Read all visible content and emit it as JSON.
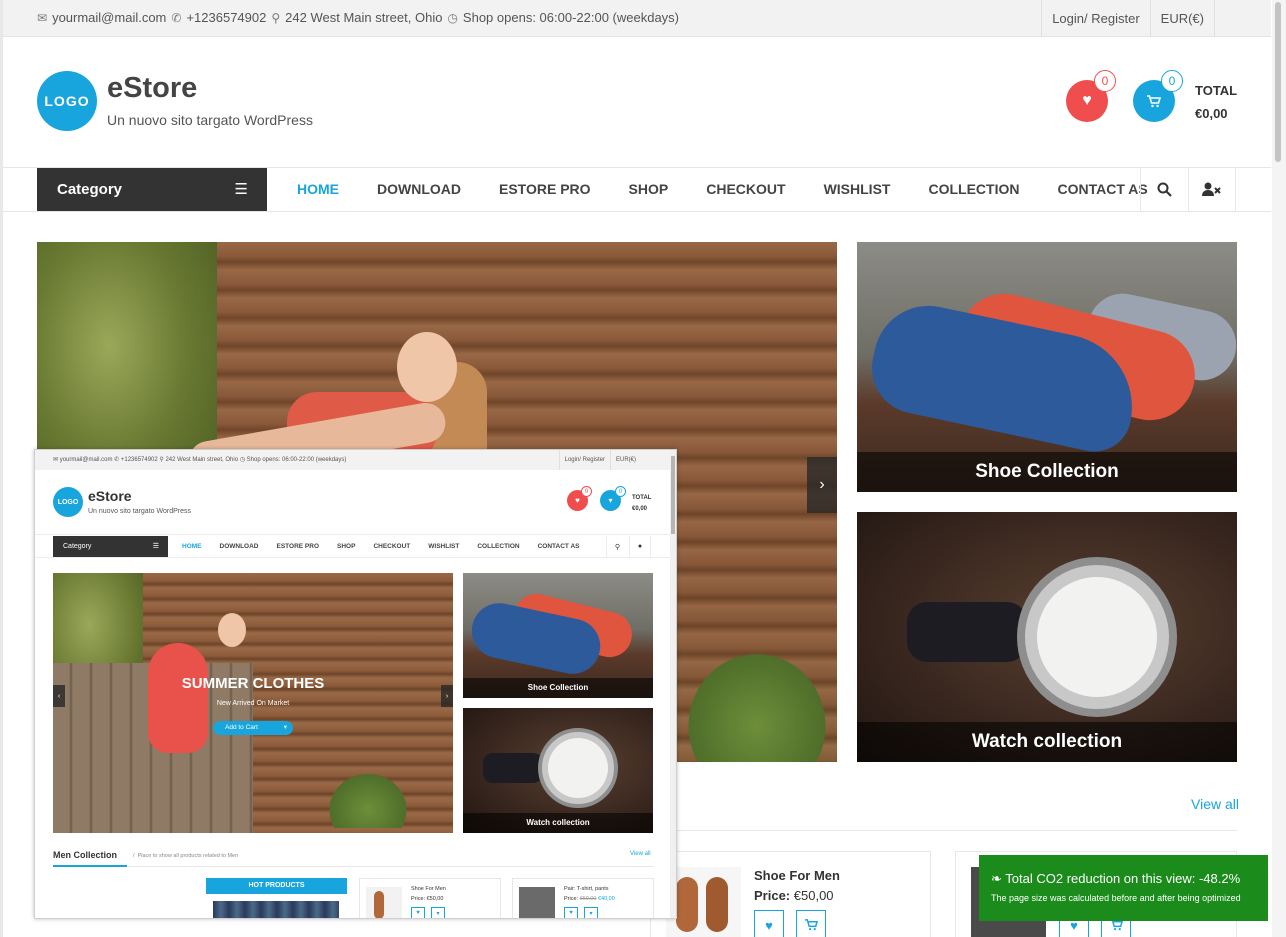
{
  "topbar": {
    "email": "yourmail@mail.com",
    "phone": "+1236574902",
    "address": "242 West Main street, Ohio",
    "hours": "Shop opens: 06:00-22:00 (weekdays)",
    "login": "Login/ Register",
    "currency": "EUR(€)"
  },
  "header": {
    "logo": "LOGO",
    "title": "eStore",
    "tagline": "Un nuovo sito targato WordPress",
    "wishlist_count": "0",
    "cart_count": "0",
    "total_label": "TOTAL",
    "total_value": "€0,00"
  },
  "nav": {
    "category": "Category",
    "items": [
      "HOME",
      "DOWNLOAD",
      "ESTORE PRO",
      "SHOP",
      "CHECKOUT",
      "WISHLIST",
      "COLLECTION",
      "CONTACT AS"
    ]
  },
  "banners": {
    "shoe": "Shoe Collection",
    "watch": "Watch collection"
  },
  "section": {
    "view_all": "View all"
  },
  "products": [
    {
      "name": "Shoe For Men",
      "price_label": "Price:",
      "price": "€50,00"
    }
  ],
  "eco": {
    "title": "Total CO2 reduction on this view: -48.2%",
    "subtitle": "The page size was calculated before and after being optimized"
  },
  "mini": {
    "hero_title": "SUMMER CLOTHES",
    "hero_sub": "New Arrived On Market",
    "hero_btn": "Add to Cart",
    "section_title": "Men Collection",
    "section_sub": "Place to show all products related to Men",
    "view_all": "View all",
    "hot": "HOT PRODUCTS",
    "cards": [
      {
        "name": "Shoe For Men",
        "price": "Price: €50,00",
        "old": "",
        "new": ""
      },
      {
        "name": "Pair: T-shirt, pants",
        "price": "Price:",
        "old": "€60,00",
        "new": "€40,00"
      }
    ]
  },
  "colors": {
    "accent": "#18a5dd",
    "wishlist": "#f04e4e",
    "dark": "#333333",
    "eco_green": "#1b8c1b"
  },
  "icons": [
    "envelope-icon",
    "phone-icon",
    "map-marker-icon",
    "clock-icon",
    "heart-icon",
    "cart-icon",
    "menu-icon",
    "search-icon",
    "user-times-icon",
    "chevron-right-icon",
    "leaf-icon"
  ]
}
